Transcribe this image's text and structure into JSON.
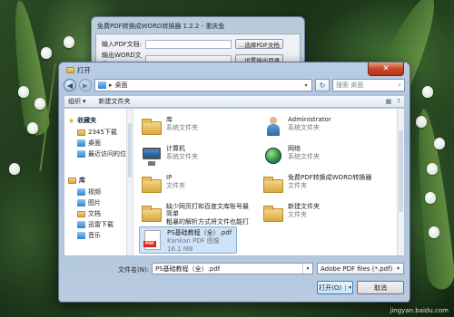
{
  "back_window": {
    "title": "免费PDF转换成WORD转换器 1.2.2 - 重庆鱼",
    "pdf_label": "输入PDF文档:",
    "pdf_button": "...选择PDF文档",
    "word_label": "输出WORD文件:",
    "word_button": "...设置输出目录"
  },
  "dialog": {
    "title": "打开",
    "close_glyph": "✕",
    "address": {
      "path_glyph": "▸",
      "path": "桌面",
      "arrow": "▾",
      "refresh_glyph": "↻"
    },
    "search": {
      "placeholder": "搜索 桌面",
      "icon_glyph": "⌕"
    },
    "toolbar": {
      "organize": "组织",
      "organize_arrow": "▾",
      "new_folder": "新建文件夹",
      "view_glyph": "▦",
      "help_glyph": "?"
    },
    "nav": {
      "favorites": "收藏夹",
      "items": [
        {
          "label": "2345下载",
          "icon": "folder-icon"
        },
        {
          "label": "桌面",
          "icon": "desktop-icon"
        },
        {
          "label": "最近访问的位置",
          "icon": "recent-places-icon"
        }
      ],
      "libraries": "库",
      "lib_items": [
        {
          "label": "视频",
          "icon": "video-library-icon"
        },
        {
          "label": "图片",
          "icon": "picture-library-icon"
        },
        {
          "label": "文档",
          "icon": "document-library-icon"
        },
        {
          "label": "迅雷下载",
          "icon": "thunder-download-icon"
        },
        {
          "label": "音乐",
          "icon": "music-library-icon"
        }
      ]
    },
    "files": [
      {
        "name": "库",
        "sub": "系统文件夹",
        "sub2": "",
        "icon": "library-folder-icon"
      },
      {
        "name": "Administrator",
        "sub": "系统文件夹",
        "sub2": "",
        "icon": "user-folder-icon"
      },
      {
        "name": "计算机",
        "sub": "系统文件夹",
        "sub2": "",
        "icon": "computer-icon"
      },
      {
        "name": "网络",
        "sub": "系统文件夹",
        "sub2": "",
        "icon": "network-icon"
      },
      {
        "name": "IP",
        "sub": "文件夹",
        "sub2": "",
        "icon": "folder-icon"
      },
      {
        "name": "免费PDF转换成WORD转换器",
        "sub": "文件夹",
        "sub2": "",
        "icon": "folder-icon"
      },
      {
        "name": "缺少网页打和百度文库账号最简单",
        "sub": "粗暴的解析方式将文件也能打入3...",
        "sub2": "文件夹",
        "icon": "folder-icon"
      },
      {
        "name": "新建文件夹",
        "sub": "文件夹",
        "sub2": "",
        "icon": "folder-icon"
      },
      {
        "name": "PS基础教程（全）.pdf",
        "sub": "Kankan PDF 图像",
        "sub2": "16.1 MB",
        "icon": "pdf-file-icon"
      }
    ],
    "filename_label": "文件名(N):",
    "filename_value": "PS基础教程（全）.pdf",
    "dropdown_arrow": "▾",
    "filetype_value": "Adobe PDF files (*.pdf)",
    "open_button": "打开(O)",
    "cancel_button": "取消"
  },
  "watermark": "jingyan.baidu.com"
}
